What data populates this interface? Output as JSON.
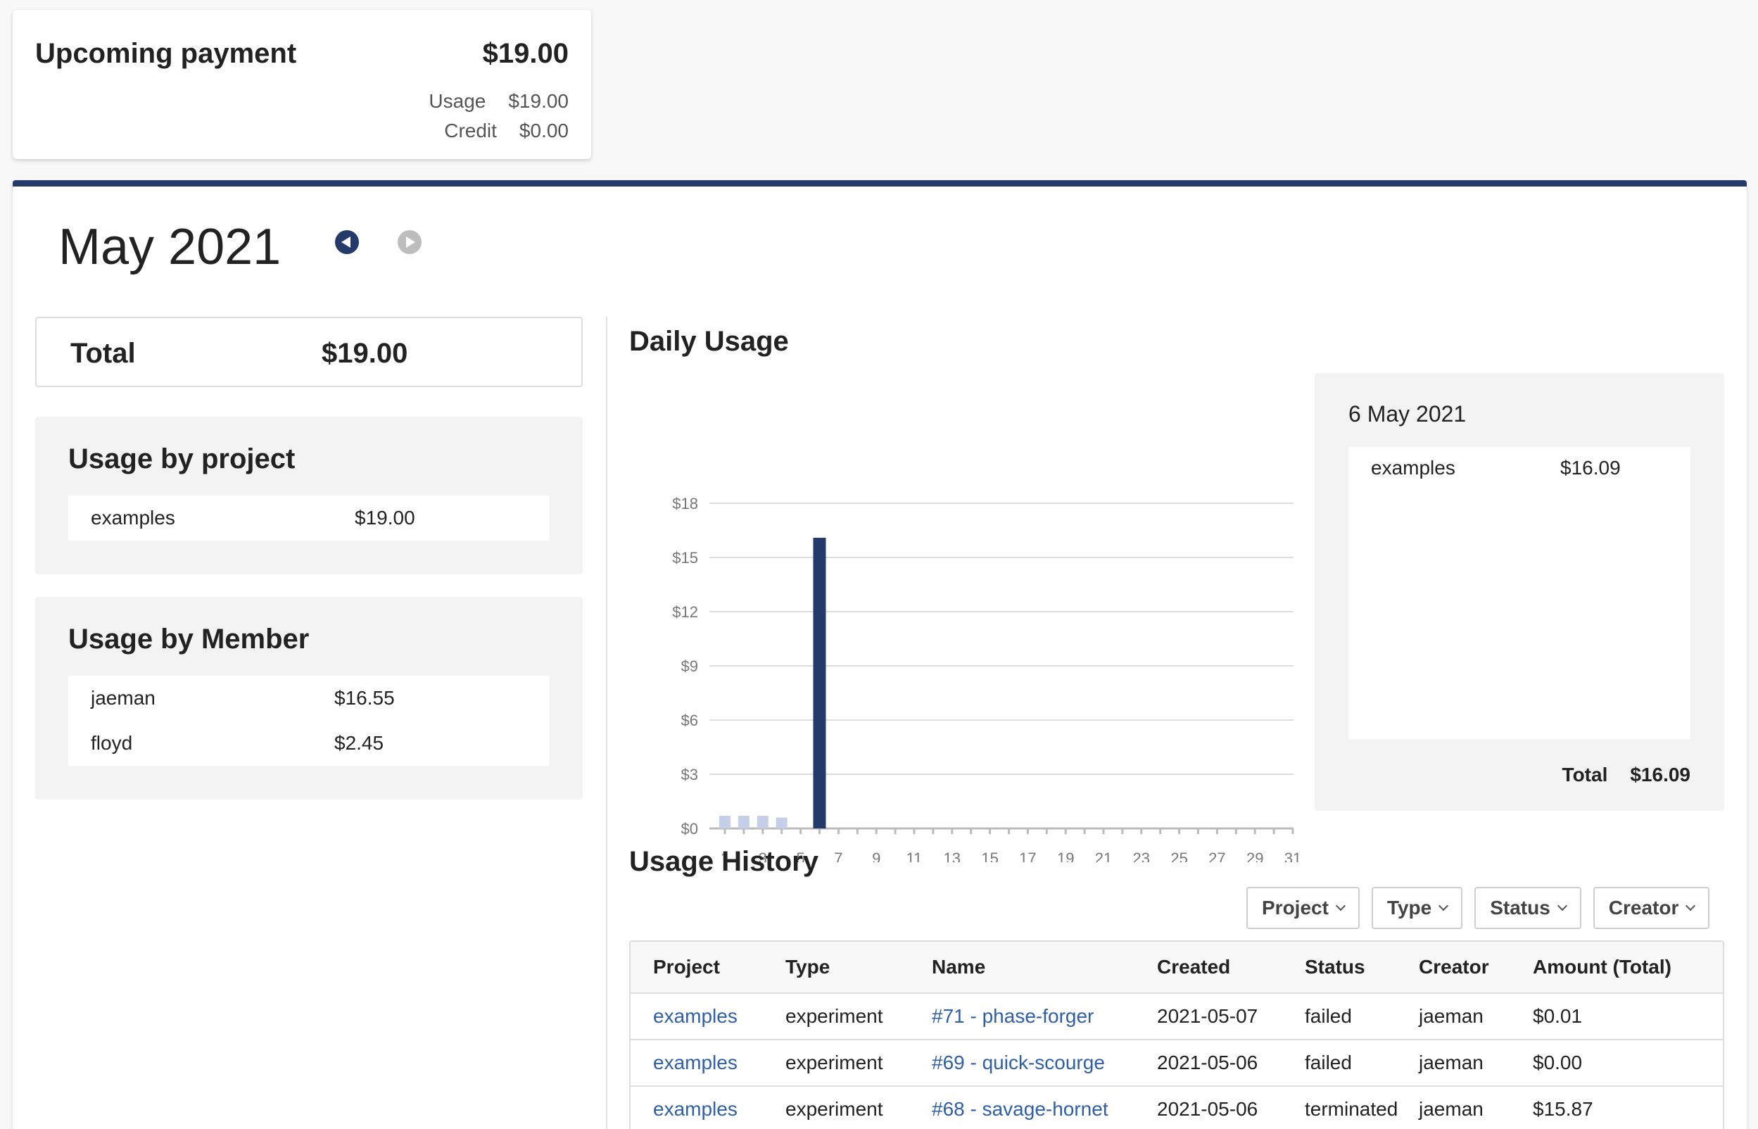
{
  "upcoming": {
    "title": "Upcoming payment",
    "amount": "$19.00",
    "usage_label": "Usage",
    "usage_value": "$19.00",
    "credit_label": "Credit",
    "credit_value": "$0.00"
  },
  "period": {
    "title": "May 2021",
    "prev_icon": "chevron-left-circle-icon",
    "next_icon": "chevron-right-circle-icon"
  },
  "total": {
    "label": "Total",
    "value": "$19.00"
  },
  "usage_by_project": {
    "title": "Usage by project",
    "items": [
      {
        "name": "examples",
        "value": "$19.00"
      }
    ]
  },
  "usage_by_member": {
    "title": "Usage by Member",
    "items": [
      {
        "name": "jaeman",
        "value": "$16.55"
      },
      {
        "name": "floyd",
        "value": "$2.45"
      }
    ]
  },
  "daily_usage": {
    "title": "Daily Usage",
    "detail": {
      "date": "6 May 2021",
      "items": [
        {
          "name": "examples",
          "value": "$16.09"
        }
      ],
      "total_label": "Total",
      "total_value": "$16.09"
    }
  },
  "chart_data": {
    "type": "bar",
    "title": "Daily Usage",
    "xlabel": "",
    "ylabel": "",
    "ylim": [
      0,
      18
    ],
    "yticks": [
      "$0",
      "$3",
      "$6",
      "$9",
      "$12",
      "$15",
      "$18"
    ],
    "xticks": [
      "1",
      "3",
      "5",
      "7",
      "9",
      "11",
      "13",
      "15",
      "17",
      "19",
      "21",
      "23",
      "25",
      "27",
      "29",
      "31"
    ],
    "x": [
      1,
      2,
      3,
      4,
      5,
      6,
      7,
      8,
      9,
      10,
      11,
      12,
      13,
      14,
      15,
      16,
      17,
      18,
      19,
      20,
      21,
      22,
      23,
      24,
      25,
      26,
      27,
      28,
      29,
      30,
      31
    ],
    "values": [
      0.7,
      0.7,
      0.7,
      0.6,
      0,
      16.09,
      0,
      0,
      0,
      0,
      0,
      0,
      0,
      0,
      0,
      0,
      0,
      0,
      0,
      0,
      0,
      0,
      0,
      0,
      0,
      0,
      0,
      0,
      0,
      0,
      0
    ],
    "highlight_index": 5,
    "colors": {
      "bar": "#c5cfe8",
      "highlight": "#233a6b",
      "grid": "#dddddd",
      "axis": "#bbbbbb",
      "tick_text": "#777777"
    },
    "grid": true,
    "legend": "none"
  },
  "usage_history": {
    "title": "Usage History",
    "filters": [
      "Project",
      "Type",
      "Status",
      "Creator"
    ],
    "columns": [
      "Project",
      "Type",
      "Name",
      "Created",
      "Status",
      "Creator",
      "Amount (Total)"
    ],
    "rows": [
      {
        "project": "examples",
        "type": "experiment",
        "name": "#71 - phase-forger",
        "created": "2021-05-07",
        "status": "failed",
        "creator": "jaeman",
        "amount": "$0.01"
      },
      {
        "project": "examples",
        "type": "experiment",
        "name": "#69 - quick-scourge",
        "created": "2021-05-06",
        "status": "failed",
        "creator": "jaeman",
        "amount": "$0.00"
      },
      {
        "project": "examples",
        "type": "experiment",
        "name": "#68 - savage-hornet",
        "created": "2021-05-06",
        "status": "terminated",
        "creator": "jaeman",
        "amount": "$15.87"
      }
    ]
  }
}
